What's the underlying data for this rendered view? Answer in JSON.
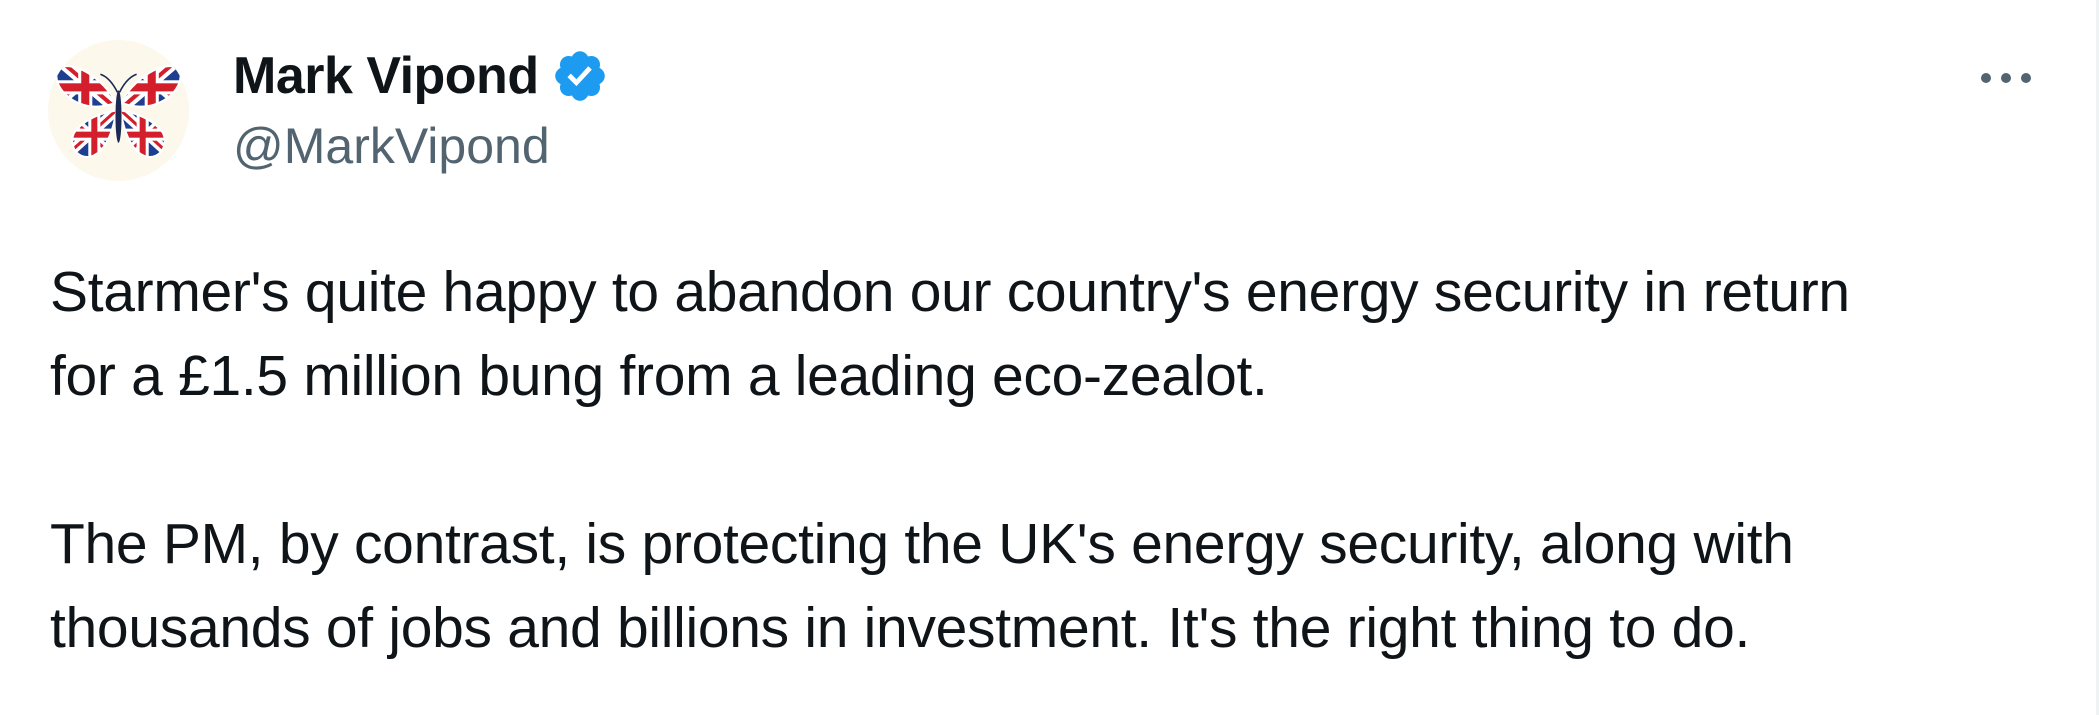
{
  "author": {
    "name": "Mark Vipond",
    "handle": "@MarkVipond",
    "verified": true,
    "avatar_icon": "union-jack-butterfly-icon",
    "verified_icon": "verified-badge-icon",
    "verified_color": "#1d9bf0"
  },
  "menu": {
    "more_icon": "more-options-icon"
  },
  "tweet": {
    "paragraphs": [
      {
        "lines": [
          "Starmer's quite happy to abandon our country's energy security in return",
          "for a £1.5 million bung from a leading eco-zealot."
        ]
      },
      {
        "lines": [
          "The PM, by contrast, is protecting the UK's energy security, along with",
          "thousands of jobs and billions in investment. It's the right thing to do."
        ]
      }
    ]
  },
  "colors": {
    "text_primary": "#0f1419",
    "text_secondary": "#536471",
    "background": "#ffffff",
    "flag_blue": "#1e3f8f",
    "flag_red": "#d21f2b"
  }
}
